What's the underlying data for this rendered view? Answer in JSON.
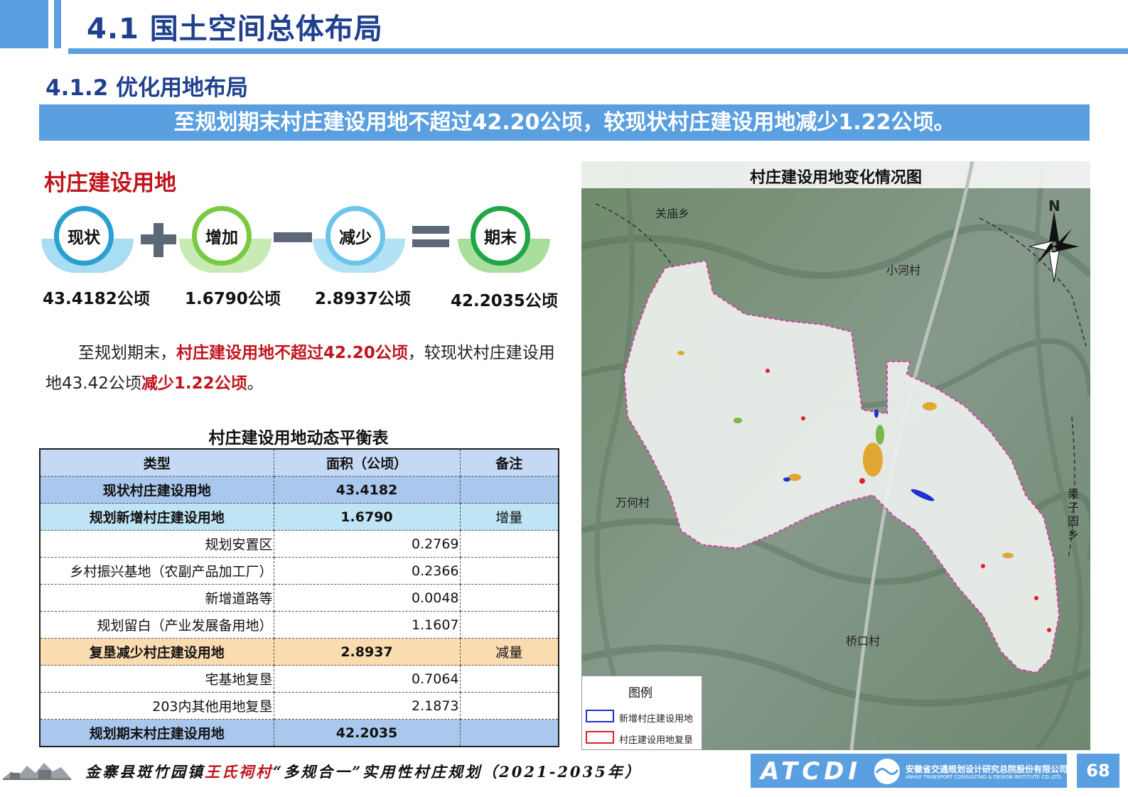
{
  "header": {
    "title": "4.1 国土空间总体布局"
  },
  "subtitle": "4.1.2 优化用地布局",
  "banner": "至规划期末村庄建设用地不超过42.20公顷，较现状村庄建设用地减少1.22公顷。",
  "section": {
    "heading": "村庄建设用地",
    "stages": [
      {
        "label": "现状",
        "value": "43.4182公顷",
        "color": "#2a9fd0",
        "wing": "#a8ddf4"
      },
      {
        "label": "增加",
        "value": "1.6790公顷",
        "color": "#7ac943",
        "wing": "#c8eab4"
      },
      {
        "label": "减少",
        "value": "2.8937公顷",
        "color": "#6cc3ec",
        "wing": "#b3e2f6"
      },
      {
        "label": "期末",
        "value": "42.2035公顷",
        "color": "#22a548",
        "wing": "#a9df9c"
      }
    ],
    "paragraph": {
      "p1": "至规划期末，",
      "p2": "村庄建设用地不超过42.20公顷",
      "p3": "，较现状村庄建设用地43.42公顷",
      "p4": "减少1.22公顷",
      "p5": "。"
    }
  },
  "table": {
    "title": "村庄建设用地动态平衡表",
    "headers": [
      "类型",
      "面积（公顷）",
      "备注"
    ],
    "rows": [
      {
        "type": "现状村庄建设用地",
        "area": "43.4182",
        "note": ""
      },
      {
        "type": "规划新增村庄建设用地",
        "area": "1.6790",
        "note": "增量"
      },
      {
        "type": "规划安置区",
        "area": "0.2769",
        "note": ""
      },
      {
        "type": "乡村振兴基地（农副产品加工厂）",
        "area": "0.2366",
        "note": ""
      },
      {
        "type": "新增道路等",
        "area": "0.0048",
        "note": ""
      },
      {
        "type": "规划留白（产业发展备用地）",
        "area": "1.1607",
        "note": ""
      },
      {
        "type": "复垦减少村庄建设用地",
        "area": "2.8937",
        "note": "减量"
      },
      {
        "type": "宅基地复垦",
        "area": "0.7064",
        "note": ""
      },
      {
        "type": "203内其他用地复垦",
        "area": "2.1873",
        "note": ""
      },
      {
        "type": "规划期末村庄建设用地",
        "area": "42.2035",
        "note": ""
      }
    ]
  },
  "map": {
    "title": "村庄建设用地变化情况图",
    "north": "N",
    "places": {
      "guanmiao": "关庙乡",
      "xiaohe": "小河村",
      "wanhe": "万何村",
      "guoziyuan": "果子园乡",
      "qiaokou": "桥口村"
    },
    "legend": {
      "title": "图例",
      "items": [
        {
          "label": "新增村庄建设用地",
          "color": "#1f2fd0"
        },
        {
          "label": "村庄建设用地复垦",
          "color": "#e0202a"
        }
      ]
    }
  },
  "footer": {
    "part1": "金寨县斑竹园镇",
    "part2": "王氏祠村",
    "part3": "“多规合一”实用性村庄规划（2021-2035年）",
    "logo": "ATCDI",
    "company_cn": "安徽省交通规划设计研究总院股份有限公司",
    "company_en": "ANHUI TRANSPORT CONSULTING & DESIGN INSTITUTE CO.,LTD.",
    "page": "68"
  }
}
